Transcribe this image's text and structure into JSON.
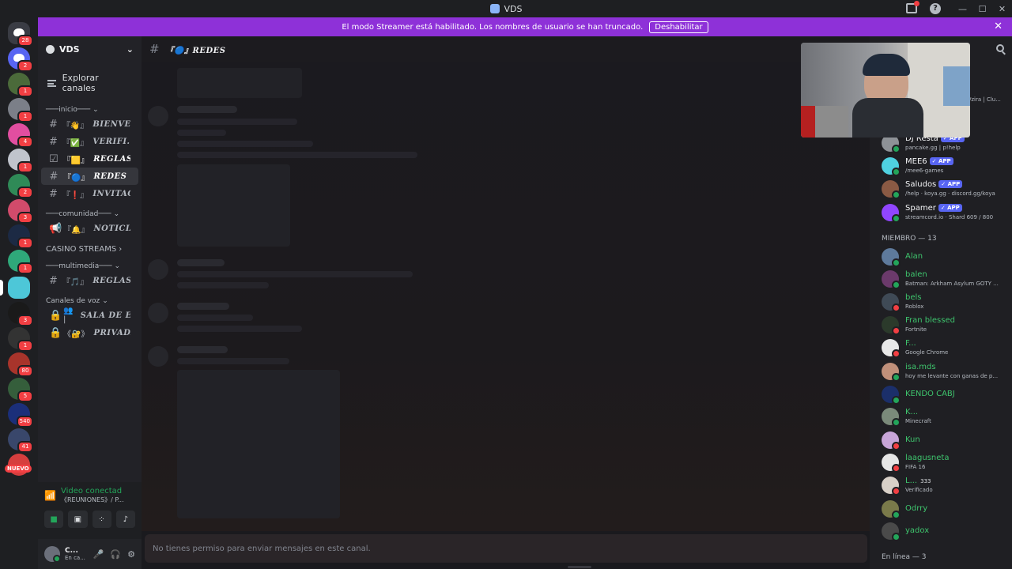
{
  "window": {
    "title": "VDS"
  },
  "banner": {
    "message": "El modo Streamer está habilitado. Los nombres de usuario se han truncado.",
    "button": "Deshabilitar"
  },
  "servers": [
    {
      "color": "#3a3c44",
      "badge": "28",
      "icon": "discord-logo-icon"
    },
    {
      "color": "#5865f2",
      "badge": "2",
      "icon": "discord-logo-icon"
    },
    {
      "color": "#4b6a3a",
      "badge": "1"
    },
    {
      "color": "#7b7f88",
      "badge": "1"
    },
    {
      "color": "#e14ea0",
      "badge": "4"
    },
    {
      "color": "#c0c4cc",
      "badge": "1"
    },
    {
      "color": "#2f8a57",
      "badge": "2"
    },
    {
      "color": "#d14b6b",
      "badge": "3"
    },
    {
      "color": "#1c2a44",
      "badge": "1"
    },
    {
      "color": "#2fa87a",
      "badge": "1"
    },
    {
      "color": "#4dc7d8",
      "badge": ""
    },
    {
      "color": "#1a1a1a",
      "badge": "3"
    },
    {
      "color": "#333333",
      "badge": "1"
    },
    {
      "color": "#a8342b",
      "badge": "80"
    },
    {
      "color": "#355e3b",
      "badge": "5"
    },
    {
      "color": "#1b2f7a",
      "badge": "540"
    },
    {
      "color": "#39476b",
      "badge": "41"
    },
    {
      "color": "#d63e3e",
      "badge": ""
    }
  ],
  "nuevo_label": "NUEVO",
  "guild": {
    "name": "VDS",
    "explore": "Explorar canales"
  },
  "categories": {
    "inicio": "───inicio───",
    "comunidad": "───comunidad───",
    "casino": "CASINO STREAMS",
    "multimedia": "───multimedia───",
    "voz": "Canales de voz"
  },
  "channels": {
    "bienvenida": {
      "prefix": "『👋』",
      "name": "BIENVE..."
    },
    "verificacion": {
      "prefix": "『✅』",
      "name": "VERIFI..."
    },
    "reglas": {
      "prefix": "『🟨』",
      "name": "REGLAS"
    },
    "redes": {
      "prefix": "『🔵』",
      "name": "REDES"
    },
    "invitaciones": {
      "prefix": "『❗』",
      "name": "INVITACI..."
    },
    "noticias": {
      "prefix": "『🔔』",
      "name": "NOTICIAS"
    },
    "reglas_multimedia": {
      "prefix": "『🎵』",
      "name": "REGLAS..."
    },
    "sala": {
      "prefix": "👥 |",
      "name": "SALA DE E..."
    },
    "privada": {
      "prefix": "《🔐》",
      "name": "PRIVADA"
    }
  },
  "voice": {
    "status": "Video conectad",
    "channel": "《REUNIONES》/ P..."
  },
  "user": {
    "name": "C...",
    "status": "En ca..."
  },
  "main": {
    "channel_title": "『🔵』REDES",
    "composer_placeholder": "No tienes permiso para enviar mensajes en este canal."
  },
  "members": {
    "top_sub": "/zira | Clu...",
    "bots": [
      {
        "name": "DJ Resta",
        "sub": "pancake.gg | p!help",
        "color": "#8e9297"
      },
      {
        "name": "MEE6",
        "sub": "/mee6-games",
        "color": "#4fd1e0"
      },
      {
        "name": "Saludos",
        "sub": "/help · koya.gg · discord.gg/koya",
        "color": "#8a5a44"
      },
      {
        "name": "Spamer",
        "sub": "streamcord.io · Shard 609 / 800",
        "color": "#9146ff"
      }
    ],
    "app_tag": "✓ APP",
    "miembro_label": "MIEMBRO — 13",
    "list": [
      {
        "name": "Alan",
        "sub": "",
        "color": "#5e7a9c",
        "status": "#23a55a"
      },
      {
        "name": "balen",
        "sub": "Batman: Arkham Asylum GOTY ...",
        "color": "#6b3a6b",
        "status": "#23a55a"
      },
      {
        "name": "bels",
        "sub": "Roblox",
        "color": "#3f4a56",
        "status": "#f23f43"
      },
      {
        "name": "Fran blessed",
        "sub": "Fortnite",
        "color": "#2b3a2b",
        "status": "#f23f43"
      },
      {
        "name": "F...",
        "sub": "Google Chrome",
        "color": "#e8e8e8",
        "status": "#f23f43"
      },
      {
        "name": "isa.mds",
        "sub": "hoy me levante con ganas de p...",
        "color": "#c0907a",
        "status": "#23a55a"
      },
      {
        "name": "KENDO CABJ",
        "sub": "",
        "color": "#1b2f6a",
        "status": "#23a55a"
      },
      {
        "name": "K...",
        "sub": "Minecraft",
        "color": "#7a8a7a",
        "status": "#23a55a"
      },
      {
        "name": "Kun",
        "sub": "",
        "color": "#c7a5d8",
        "status": "#f23f43"
      },
      {
        "name": "laagusneta",
        "sub": "FIFA 16",
        "color": "#e6e6e6",
        "status": "#f23f43"
      },
      {
        "name": "L...",
        "sub": "Verificado",
        "badge": "333",
        "color": "#d8d0c8",
        "status": "#f23f43"
      },
      {
        "name": "Odrry",
        "sub": "",
        "color": "#7a7a4a",
        "status": "#23a55a"
      },
      {
        "name": "yadox",
        "sub": "",
        "color": "#4a4a4a",
        "status": "#23a55a"
      }
    ],
    "online_label": "En línea — 3"
  }
}
